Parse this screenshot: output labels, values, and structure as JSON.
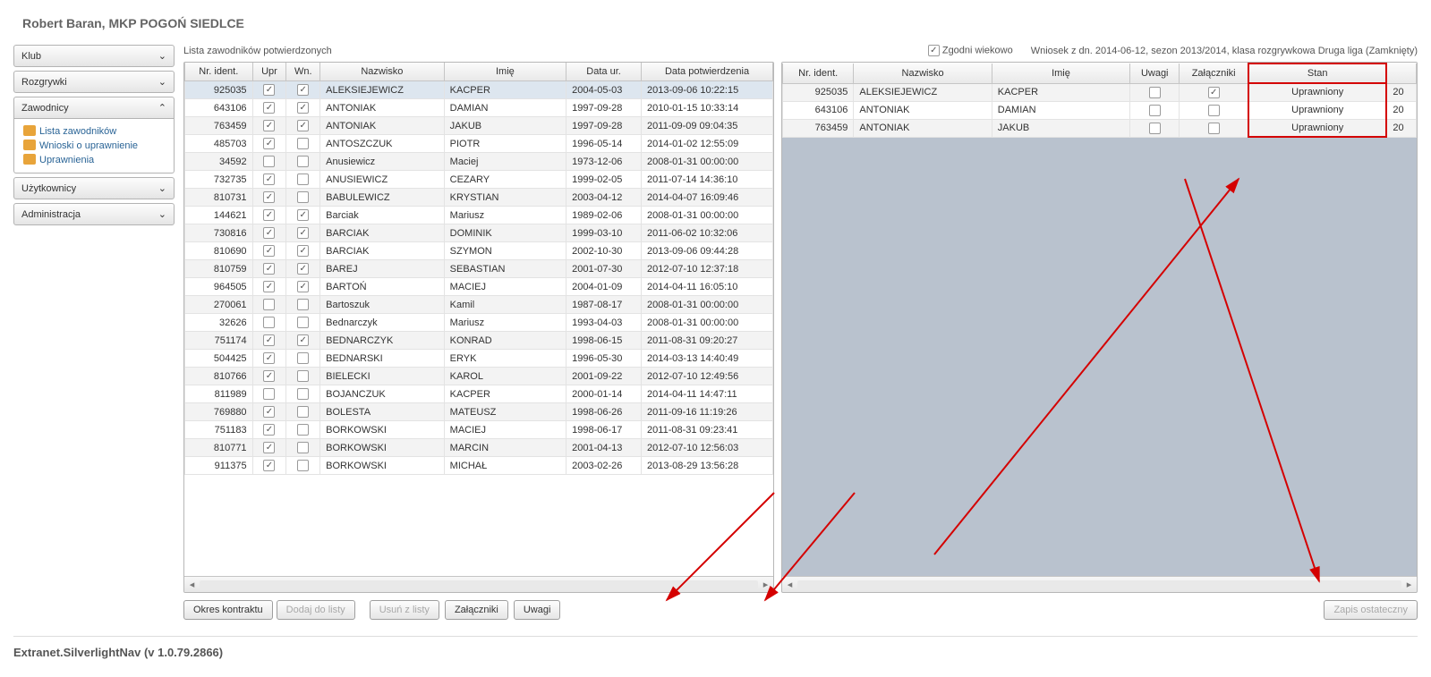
{
  "page_title": "Robert Baran, MKP POGOŃ SIEDLCE",
  "sidebar": {
    "items": [
      {
        "label": "Klub",
        "expanded": false
      },
      {
        "label": "Rozgrywki",
        "expanded": false
      },
      {
        "label": "Zawodnicy",
        "expanded": true,
        "subitems": [
          {
            "label": "Lista zawodników"
          },
          {
            "label": "Wnioski o uprawnienie"
          },
          {
            "label": "Uprawnienia"
          }
        ]
      },
      {
        "label": "Użytkownicy",
        "expanded": false
      },
      {
        "label": "Administracja",
        "expanded": false
      }
    ]
  },
  "toolbar": {
    "list_label": "Lista zawodników potwierdzonych",
    "age_check_label": "Zgodni wiekowo",
    "age_checked": true,
    "wniosek_text": "Wniosek z dn. 2014-06-12, sezon 2013/2014, klasa rozgrywkowa Druga liga (Zamknięty)"
  },
  "left_table": {
    "headers": [
      "Nr. ident.",
      "Upr",
      "Wn.",
      "Nazwisko",
      "Imię",
      "Data ur.",
      "Data potwierdzenia"
    ],
    "rows": [
      {
        "id": "925035",
        "upr": true,
        "wn": true,
        "nazwisko": "ALEKSIEJEWICZ",
        "imie": "KACPER",
        "data_ur": "2004-05-03",
        "data_pot": "2013-09-06 10:22:15",
        "selected": true
      },
      {
        "id": "643106",
        "upr": true,
        "wn": true,
        "nazwisko": "ANTONIAK",
        "imie": "DAMIAN",
        "data_ur": "1997-09-28",
        "data_pot": "2010-01-15 10:33:14"
      },
      {
        "id": "763459",
        "upr": true,
        "wn": true,
        "nazwisko": "ANTONIAK",
        "imie": "JAKUB",
        "data_ur": "1997-09-28",
        "data_pot": "2011-09-09 09:04:35"
      },
      {
        "id": "485703",
        "upr": true,
        "wn": false,
        "nazwisko": "ANTOSZCZUK",
        "imie": "PIOTR",
        "data_ur": "1996-05-14",
        "data_pot": "2014-01-02 12:55:09"
      },
      {
        "id": "34592",
        "upr": false,
        "wn": false,
        "nazwisko": "Anusiewicz",
        "imie": "Maciej",
        "data_ur": "1973-12-06",
        "data_pot": "2008-01-31 00:00:00"
      },
      {
        "id": "732735",
        "upr": true,
        "wn": false,
        "nazwisko": "ANUSIEWICZ",
        "imie": "CEZARY",
        "data_ur": "1999-02-05",
        "data_pot": "2011-07-14 14:36:10"
      },
      {
        "id": "810731",
        "upr": true,
        "wn": false,
        "nazwisko": "BABULEWICZ",
        "imie": "KRYSTIAN",
        "data_ur": "2003-04-12",
        "data_pot": "2014-04-07 16:09:46"
      },
      {
        "id": "144621",
        "upr": true,
        "wn": true,
        "nazwisko": "Barciak",
        "imie": "Mariusz",
        "data_ur": "1989-02-06",
        "data_pot": "2008-01-31 00:00:00"
      },
      {
        "id": "730816",
        "upr": true,
        "wn": true,
        "nazwisko": "BARCIAK",
        "imie": "DOMINIK",
        "data_ur": "1999-03-10",
        "data_pot": "2011-06-02 10:32:06"
      },
      {
        "id": "810690",
        "upr": true,
        "wn": true,
        "nazwisko": "BARCIAK",
        "imie": "SZYMON",
        "data_ur": "2002-10-30",
        "data_pot": "2013-09-06 09:44:28"
      },
      {
        "id": "810759",
        "upr": true,
        "wn": true,
        "nazwisko": "BAREJ",
        "imie": "SEBASTIAN",
        "data_ur": "2001-07-30",
        "data_pot": "2012-07-10 12:37:18"
      },
      {
        "id": "964505",
        "upr": true,
        "wn": true,
        "nazwisko": "BARTOŃ",
        "imie": "MACIEJ",
        "data_ur": "2004-01-09",
        "data_pot": "2014-04-11 16:05:10"
      },
      {
        "id": "270061",
        "upr": false,
        "wn": false,
        "nazwisko": "Bartoszuk",
        "imie": "Kamil",
        "data_ur": "1987-08-17",
        "data_pot": "2008-01-31 00:00:00"
      },
      {
        "id": "32626",
        "upr": false,
        "wn": false,
        "nazwisko": "Bednarczyk",
        "imie": "Mariusz",
        "data_ur": "1993-04-03",
        "data_pot": "2008-01-31 00:00:00"
      },
      {
        "id": "751174",
        "upr": true,
        "wn": true,
        "nazwisko": "BEDNARCZYK",
        "imie": "KONRAD",
        "data_ur": "1998-06-15",
        "data_pot": "2011-08-31 09:20:27"
      },
      {
        "id": "504425",
        "upr": true,
        "wn": false,
        "nazwisko": "BEDNARSKI",
        "imie": "ERYK",
        "data_ur": "1996-05-30",
        "data_pot": "2014-03-13 14:40:49"
      },
      {
        "id": "810766",
        "upr": true,
        "wn": false,
        "nazwisko": "BIELECKI",
        "imie": "KAROL",
        "data_ur": "2001-09-22",
        "data_pot": "2012-07-10 12:49:56"
      },
      {
        "id": "811989",
        "upr": false,
        "wn": false,
        "nazwisko": "BOJANCZUK",
        "imie": "KACPER",
        "data_ur": "2000-01-14",
        "data_pot": "2014-04-11 14:47:11"
      },
      {
        "id": "769880",
        "upr": true,
        "wn": false,
        "nazwisko": "BOLESTA",
        "imie": "MATEUSZ",
        "data_ur": "1998-06-26",
        "data_pot": "2011-09-16 11:19:26"
      },
      {
        "id": "751183",
        "upr": true,
        "wn": false,
        "nazwisko": "BORKOWSKI",
        "imie": "MACIEJ",
        "data_ur": "1998-06-17",
        "data_pot": "2011-08-31 09:23:41"
      },
      {
        "id": "810771",
        "upr": true,
        "wn": false,
        "nazwisko": "BORKOWSKI",
        "imie": "MARCIN",
        "data_ur": "2001-04-13",
        "data_pot": "2012-07-10 12:56:03"
      },
      {
        "id": "911375",
        "upr": true,
        "wn": false,
        "nazwisko": "BORKOWSKI",
        "imie": "MICHAŁ",
        "data_ur": "2003-02-26",
        "data_pot": "2013-08-29 13:56:28"
      }
    ]
  },
  "right_table": {
    "headers": [
      "Nr. ident.",
      "Nazwisko",
      "Imię",
      "Uwagi",
      "Załączniki",
      "Stan",
      ""
    ],
    "rows": [
      {
        "id": "925035",
        "nazwisko": "ALEKSIEJEWICZ",
        "imie": "KACPER",
        "uwagi": false,
        "zal": true,
        "stan": "Uprawniony",
        "extra": "20"
      },
      {
        "id": "643106",
        "nazwisko": "ANTONIAK",
        "imie": "DAMIAN",
        "uwagi": false,
        "zal": false,
        "stan": "Uprawniony",
        "extra": "20"
      },
      {
        "id": "763459",
        "nazwisko": "ANTONIAK",
        "imie": "JAKUB",
        "uwagi": false,
        "zal": false,
        "stan": "Uprawniony",
        "extra": "20"
      }
    ]
  },
  "buttons": {
    "okres": "Okres kontraktu",
    "dodaj": "Dodaj do listy",
    "usun": "Usuń z listy",
    "zal": "Załączniki",
    "uwagi": "Uwagi",
    "zapis": "Zapis ostateczny"
  },
  "footer": "Extranet.SilverlightNav (v 1.0.79.2866)"
}
